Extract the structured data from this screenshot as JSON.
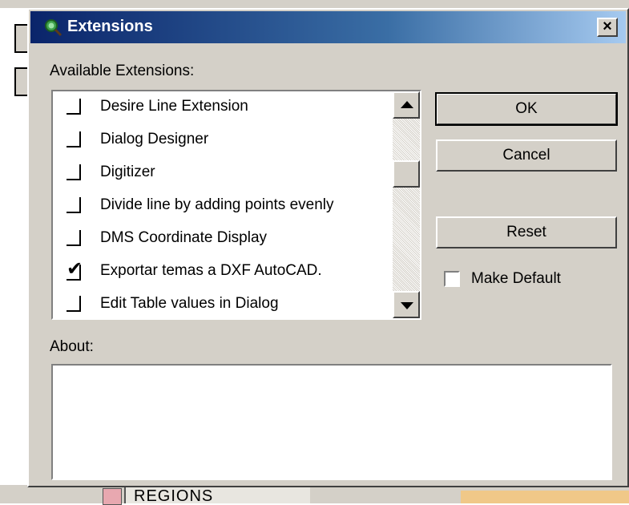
{
  "window": {
    "title": "Extensions",
    "icon": "extensions-magnifier-icon",
    "close_label": "×"
  },
  "labels": {
    "available_extensions": "Available Extensions:",
    "about": "About:"
  },
  "extensions": [
    {
      "label": "Desire Line Extension",
      "checked": false
    },
    {
      "label": "Dialog Designer",
      "checked": false
    },
    {
      "label": "Digitizer",
      "checked": false
    },
    {
      "label": "Divide line by adding points evenly",
      "checked": false
    },
    {
      "label": "DMS Coordinate Display",
      "checked": false
    },
    {
      "label": "Exportar temas a DXF AutoCAD.",
      "checked": true
    },
    {
      "label": "Edit Table values in Dialog",
      "checked": false
    }
  ],
  "buttons": {
    "ok": "OK",
    "cancel": "Cancel",
    "reset": "Reset"
  },
  "make_default": {
    "label": "Make Default",
    "checked": false
  },
  "about_text": "",
  "background": {
    "layer_label": "REGIONS"
  },
  "colors": {
    "titlebar_start": "#0a246a",
    "titlebar_end": "#a6caf0",
    "dialog_face": "#d4d0c8"
  }
}
